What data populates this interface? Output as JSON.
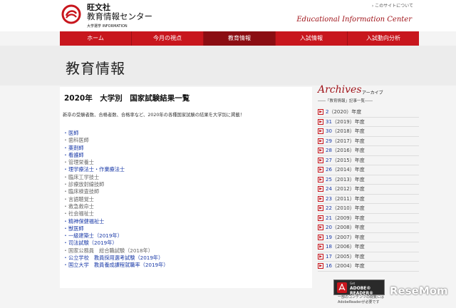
{
  "header": {
    "brand_line1": "旺文社",
    "brand_line2": "教育情報センター",
    "brand_line3": "大学選学 INFORMATION",
    "site_link": "このサイトについて",
    "center_en": "Educational Information Center"
  },
  "nav": [
    {
      "label": "ホーム"
    },
    {
      "label": "今月の視点"
    },
    {
      "label": "教育情報"
    },
    {
      "label": "入試情報"
    },
    {
      "label": "入試動向分析"
    }
  ],
  "page_title": "教育情報",
  "main": {
    "heading": "2020年　大学別　国家試験結果一覧",
    "desc": "新卒の受験者数、合格者数、合格率など、2020年の各種国家試験の結果を大学別に掲載！",
    "items": [
      {
        "label": "医師",
        "link": true
      },
      {
        "label": "歯科医師",
        "link": false
      },
      {
        "label": "薬剤師",
        "link": true
      },
      {
        "label": "看護師",
        "link": true
      },
      {
        "label": "管理栄養士",
        "link": false
      },
      {
        "label": "理学療法士・作業療法士",
        "link": true
      },
      {
        "label": "臨床工学技士",
        "link": false
      },
      {
        "label": "診療放射線技師",
        "link": false
      },
      {
        "label": "臨床検査技師",
        "link": false
      },
      {
        "label": "言語聴覚士",
        "link": false
      },
      {
        "label": "救急救命士",
        "link": false
      },
      {
        "label": "社会福祉士",
        "link": false
      },
      {
        "label": "精神保健福祉士",
        "link": true
      },
      {
        "label": "獣医師",
        "link": true
      },
      {
        "label": "一級建築士（2019年）",
        "link": true
      },
      {
        "label": "司法試験（2019年）",
        "link": true
      },
      {
        "label": "国家公務員　総合職試験（2018年）",
        "link": false
      },
      {
        "label": "公立学校　教員採用選考試験（2019年）",
        "link": true
      },
      {
        "label": "国立大学　教員養成課程就職率（2019年）",
        "link": true
      }
    ]
  },
  "sidebar": {
    "archives_title": "Archives",
    "archives_sub": "アーカイブ",
    "archives_note": "――「教育情報」記事一覧――",
    "items": [
      {
        "count": "2",
        "year": "（2020）年度"
      },
      {
        "count": "31",
        "year": "（2019）年度"
      },
      {
        "count": "30",
        "year": "（2018）年度"
      },
      {
        "count": "29",
        "year": "（2017）年度"
      },
      {
        "count": "28",
        "year": "（2016）年度"
      },
      {
        "count": "27",
        "year": "（2015）年度"
      },
      {
        "count": "26",
        "year": "（2014）年度"
      },
      {
        "count": "25",
        "year": "（2013）年度"
      },
      {
        "count": "24",
        "year": "（2012）年度"
      },
      {
        "count": "23",
        "year": "（2011）年度"
      },
      {
        "count": "22",
        "year": "（2010）年度"
      },
      {
        "count": "21",
        "year": "（2009）年度"
      },
      {
        "count": "20",
        "year": "（2008）年度"
      },
      {
        "count": "19",
        "year": "（2007）年度"
      },
      {
        "count": "18",
        "year": "（2006）年度"
      },
      {
        "count": "17",
        "year": "（2005）年度"
      },
      {
        "count": "16",
        "year": "（2004）年度"
      }
    ]
  },
  "adobe": {
    "get": "Get",
    "label": "ADOBE® READER®",
    "note": "一部のコンテンツの閲覧には AdobeReaderが必要です"
  },
  "watermark": "ReseMom"
}
